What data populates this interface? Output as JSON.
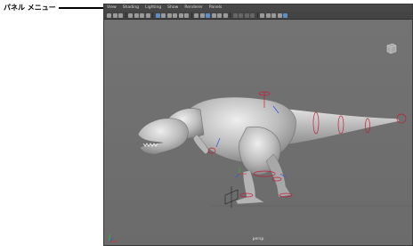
{
  "callout": {
    "label": "パネル メニュー"
  },
  "menubar": {
    "items": [
      "View",
      "Shading",
      "Lighting",
      "Show",
      "Renderer",
      "Panels"
    ]
  },
  "viewcube": {
    "label": "BACK"
  },
  "viewport": {
    "camera_label": "persp"
  },
  "colors": {
    "rig": "#c0203a",
    "selection": "#5b8fc8",
    "axis_x": "#d03030",
    "axis_y": "#30c030",
    "axis_z": "#3050e0"
  }
}
